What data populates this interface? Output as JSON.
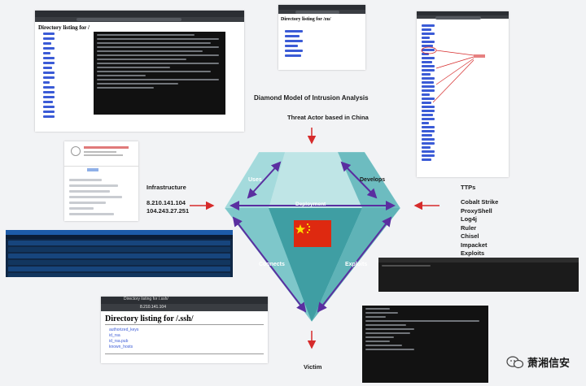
{
  "diagram": {
    "title": "Diamond Model of Intrusion Analysis",
    "threat_actor": "Threat Actor based in China",
    "victim": "Victim",
    "infrastructure": {
      "label": "Infrastructure",
      "ips": [
        "8.210.141.104",
        "104.243.27.251"
      ]
    },
    "ttps": {
      "label": "TTPs",
      "items": [
        "Cobalt Strike",
        "ProxyShell",
        "Log4j",
        "Ruler",
        "Chisel",
        "Impacket",
        "Exploits"
      ]
    },
    "edges": {
      "uses": "Uses",
      "develops": "Develops",
      "deployment": "Deployment",
      "connects": "Connects",
      "exploits": "Exploits"
    }
  },
  "screenshots": {
    "top_left_title": "Directory listing for /",
    "top_center_title": "Directory listing for /zu/",
    "bottom_center_title": "Directory listing for /.ssh/",
    "bottom_center_url": "8.210.141.104",
    "bottom_center_tab": "Directory listing for /.ssh/",
    "ssh_files": [
      "authorized_keys",
      "id_rsa",
      "id_rsa.pub",
      "known_hosts"
    ]
  },
  "watermark": {
    "text": "萧湘信安"
  },
  "colors": {
    "diamond_fill": "#8fd0d3",
    "diamond_dark": "#3f9ea3",
    "diamond_mid": "#6dbcc0",
    "arrow_red": "#d62b2b",
    "arrow_purple": "#5a2ea0",
    "flag_red": "#de2910",
    "flag_star": "#ffde00"
  }
}
